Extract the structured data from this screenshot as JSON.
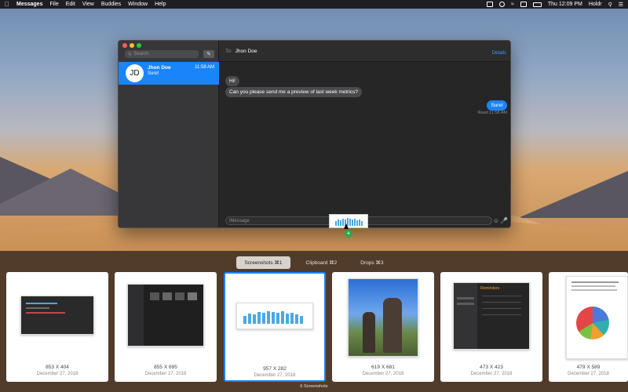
{
  "menubar": {
    "app": "Messages",
    "items": [
      "File",
      "Edit",
      "View",
      "Buddies",
      "Window",
      "Help"
    ],
    "clock": "Thu 12:09 PM",
    "user": "Holdr"
  },
  "messages": {
    "search_placeholder": "Search",
    "conversation": {
      "initials": "JD",
      "name": "Jhon Doe",
      "time": "11:58 AM",
      "preview": "Sure!"
    },
    "header": {
      "to_label": "To:",
      "recipient": "Jhon Doe",
      "details": "Details"
    },
    "bubbles": {
      "in1": "Hi!",
      "in2": "Can you please send me a preview of last week metrics?",
      "out1": "Sure!"
    },
    "read_receipt": "Read 11:58 AM",
    "input_placeholder": "iMessage"
  },
  "shelf": {
    "tabs": [
      {
        "label": "Screenshots ⌘1",
        "active": true
      },
      {
        "label": "Clipboard ⌘2",
        "active": false
      },
      {
        "label": "Drops ⌘3",
        "active": false
      }
    ],
    "cards": [
      {
        "dims": "853 X 404",
        "date": "December 27, 2018"
      },
      {
        "dims": "855 X 695",
        "date": "December 27, 2018"
      },
      {
        "dims": "957 X 282",
        "date": "December 27, 2018"
      },
      {
        "dims": "619 X 681",
        "date": "December 27, 2018"
      },
      {
        "dims": "473 X 423",
        "date": "December 27, 2018"
      },
      {
        "dims": "479 X 589",
        "date": "December 27, 2018"
      }
    ],
    "footer": "6 Screenshots",
    "reminders_title": "Reminders"
  },
  "colors": {
    "accent": "#1a84f9",
    "drop_plus": "#28a745"
  }
}
